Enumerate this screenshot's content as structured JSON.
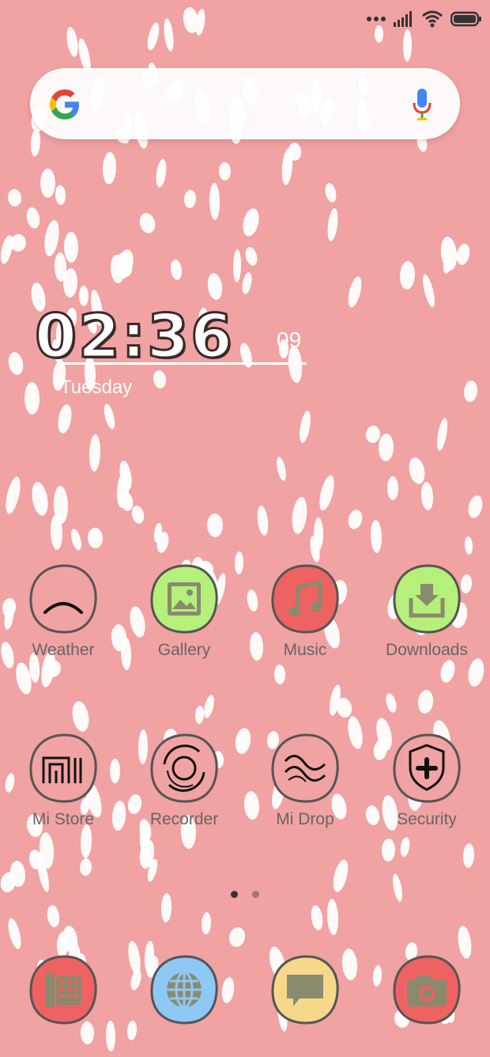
{
  "clock": {
    "time": "02:36",
    "seconds": "09",
    "day": "Tuesday"
  },
  "search": {
    "brand": "Google"
  },
  "status_bar": {
    "icons": [
      "more-dots-icon",
      "signal-icon",
      "wifi-icon",
      "battery-icon"
    ]
  },
  "apps_row1": [
    {
      "label": "Weather",
      "icon": "weather-icon",
      "color": "#f1a2a2"
    },
    {
      "label": "Gallery",
      "icon": "gallery-icon",
      "color": "#b5f07a"
    },
    {
      "label": "Music",
      "icon": "music-icon",
      "color": "#ef6262"
    },
    {
      "label": "Downloads",
      "icon": "downloads-icon",
      "color": "#b5f07a"
    }
  ],
  "apps_row2": [
    {
      "label": "Mi Store",
      "icon": "mi-store-icon",
      "color": "#f1a2a2"
    },
    {
      "label": "Recorder",
      "icon": "recorder-icon",
      "color": "#f1a2a2"
    },
    {
      "label": "Mi Drop",
      "icon": "mi-drop-icon",
      "color": "#f1a2a2"
    },
    {
      "label": "Security",
      "icon": "security-icon",
      "color": "#f1a2a2"
    }
  ],
  "dock": [
    {
      "icon": "phone-icon",
      "color": "#ef6262"
    },
    {
      "icon": "browser-icon",
      "color": "#8ec8f5"
    },
    {
      "icon": "messaging-icon",
      "color": "#f7d88a"
    },
    {
      "icon": "camera-icon",
      "color": "#ef6262"
    }
  ],
  "page_indicator": {
    "pages": 2,
    "current": 1
  }
}
